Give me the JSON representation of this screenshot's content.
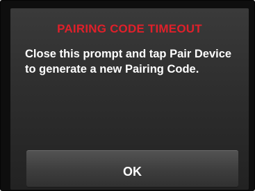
{
  "dialog": {
    "title": "PAIRING CODE TIMEOUT",
    "message": "Close this prompt and tap Pair Device to generate a new Pairing Code.",
    "ok_label": "OK"
  },
  "colors": {
    "title": "#e0202a",
    "text": "#ffffff",
    "background": "#2e2e2e"
  }
}
